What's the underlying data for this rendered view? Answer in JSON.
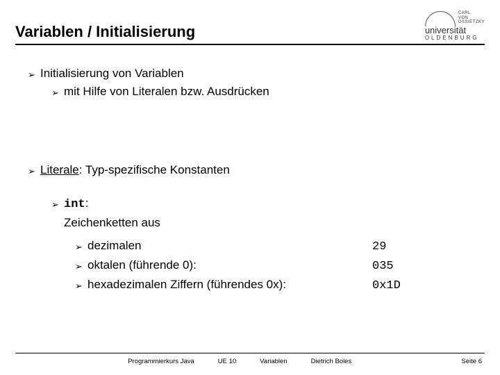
{
  "header": {
    "title": "Variablen / Initialisierung",
    "logo": {
      "line1": "CARL",
      "line2": "VON",
      "line3": "OSSIETZKY",
      "uni": "universität",
      "city": "OLDENBURG"
    }
  },
  "body": {
    "l1": "Initialisierung von Variablen",
    "l2": "mit Hilfe von Literalen bzw. Ausdrücken",
    "l3a": " Literale",
    "l3b": ": Typ-spezifische Konstanten",
    "l4a": "int",
    "l4b": ":",
    "l5": "Zeichenketten aus",
    "l6": "dezimalen",
    "l7": "oktalen (führende 0):",
    "l8": "hexadezimalen Ziffern (führendes 0x):",
    "v6": "29",
    "v7": "035",
    "v8": "0x1D"
  },
  "footer": {
    "c1": "Programmierkurs Java",
    "c2": "UE 10",
    "c3": "Variablen",
    "c4": "Dietrich Boles",
    "page": "Seite 6"
  },
  "marker": "➢"
}
